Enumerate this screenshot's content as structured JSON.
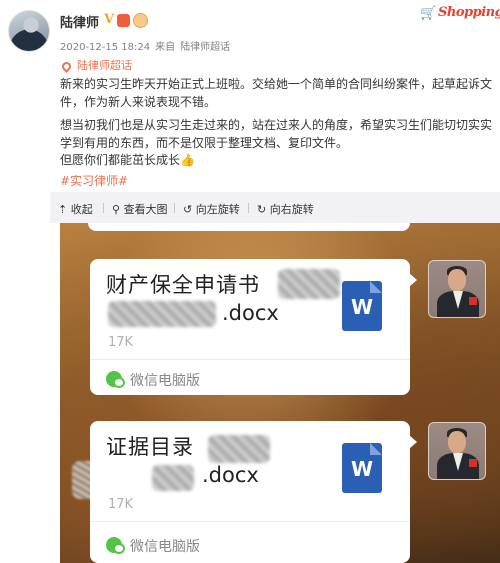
{
  "header": {
    "author": "陆律师",
    "verified_mark": "V",
    "timestamp": "2020-12-15 18:24",
    "source_prefix": "来自",
    "source": "陆律师超话",
    "corner_logo_text": "Shopping"
  },
  "post": {
    "chaohua_label": "陆律师超话",
    "paragraph_1": "新来的实习生昨天开始正式上班啦。交给她一个简单的合同纠纷案件，起草起诉文件，作为新人来说表现不错。",
    "paragraph_2": "想当初我们也是从实习生走过来的，站在过来人的角度，希望实习生们能切切实实学到有用的东西，而不是仅限于整理文档、复印文件。",
    "paragraph_3": "但愿你们都能茁长成长👍",
    "topic": "#实习律师#"
  },
  "image_toolbar": {
    "collapse": "收起",
    "view_large": "查看大图",
    "rotate_left": "向左旋转",
    "rotate_right": "向右旋转"
  },
  "screenshot": {
    "file_1": {
      "name": "财产保全申请书",
      "ext": ".docx",
      "size": "17K",
      "source": "微信电脑版",
      "icon_letter": "W"
    },
    "file_2": {
      "name": "证据目录",
      "ext": ".docx",
      "size": "17K",
      "source": "微信电脑版",
      "icon_letter": "W"
    }
  },
  "colors": {
    "accent": "#eb7350",
    "word_icon": "#2b5fb4",
    "wechat_green": "#53c447"
  },
  "icons": [
    "avatar",
    "verified-v-icon",
    "location-pin-icon",
    "collapse-arrow-icon",
    "search-icon",
    "rotate-left-icon",
    "rotate-right-icon",
    "word-doc-icon",
    "wechat-icon"
  ]
}
